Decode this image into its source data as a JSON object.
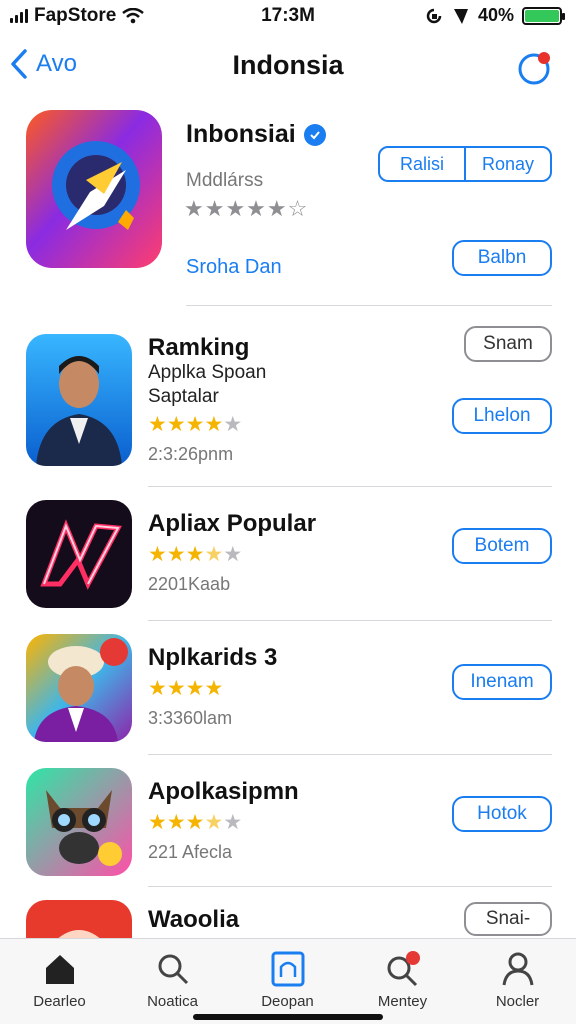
{
  "status": {
    "carrier": "FapStore",
    "time": "17:3M",
    "battery": "40%"
  },
  "nav": {
    "back_label": "Avo",
    "title": "Indonsia"
  },
  "featured": {
    "name": "Inbonsiai",
    "subtitle": "Mddlárss",
    "stars": "★★★★★☆",
    "link": "Sroha Dan",
    "seg_left": "Ralisi",
    "seg_right": "Ronay",
    "action": "Balbn"
  },
  "rows": [
    {
      "name": "Ramking",
      "sub1": "Applka Spoan",
      "sub2": "Saptalar",
      "rating": 4,
      "meta": "2:3:26pnm",
      "top_button": "Snam",
      "button": "Lhelon"
    },
    {
      "name": "Apliax Popular",
      "rating": 3.5,
      "meta": "2201Kaab",
      "button": "Botem"
    },
    {
      "name": "Nplkarids 3",
      "rating": 4,
      "meta": "3:3360lam",
      "button": "Inenam"
    },
    {
      "name": "Apolkasipmn",
      "rating": 3.5,
      "meta": "221 Afecla",
      "button": "Hotok"
    },
    {
      "name": "Waoolia",
      "button": "Snai-"
    }
  ],
  "tabs": [
    {
      "label": "Dearleo",
      "icon": "home-icon"
    },
    {
      "label": "Noatica",
      "icon": "search-icon"
    },
    {
      "label": "Deopan",
      "icon": "square-icon"
    },
    {
      "label": "Mentey",
      "icon": "search-badge-icon"
    },
    {
      "label": "Nocler",
      "icon": "person-icon"
    }
  ],
  "colors": {
    "accent": "#1a7df0",
    "star": "#f5b400",
    "battery": "#34c759"
  }
}
